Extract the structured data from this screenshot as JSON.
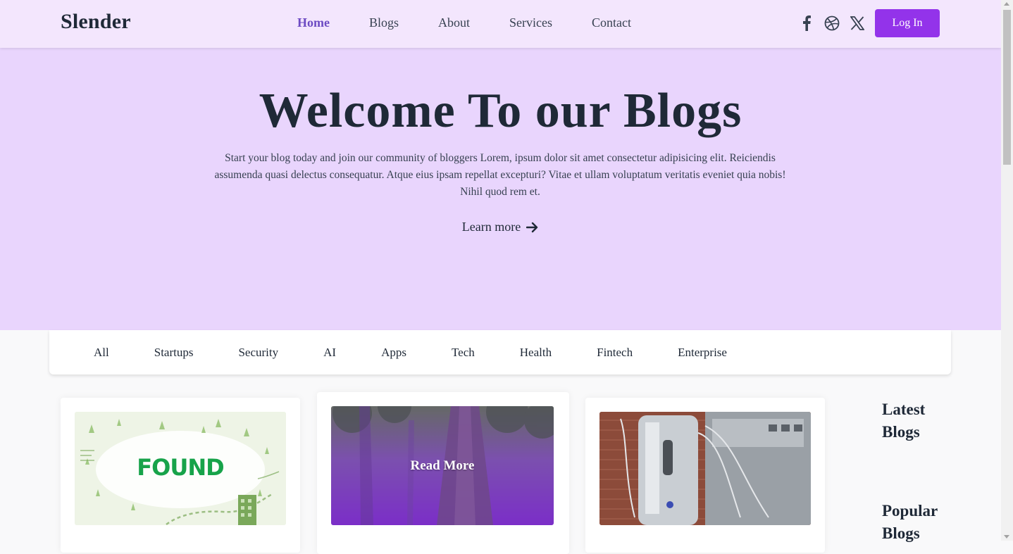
{
  "header": {
    "logo": "Slender",
    "nav": [
      "Home",
      "Blogs",
      "About",
      "Services",
      "Contact"
    ],
    "active_nav": "Home",
    "social_icons": [
      "facebook-icon",
      "dribbble-icon",
      "x-icon"
    ],
    "login_label": "Log In"
  },
  "hero": {
    "title": "Welcome To our Blogs",
    "description": "Start your blog today and join our community of bloggers Lorem, ipsum dolor sit amet consectetur adipisicing elit. Reiciendis assumenda quasi delectus consequatur. Atque eius ipsam repellat excepturi? Vitae et ullam voluptatum veritatis eveniet quia nobis! Nihil quod rem et.",
    "cta": "Learn more"
  },
  "categories": [
    "All",
    "Startups",
    "Security",
    "AI",
    "Apps",
    "Tech",
    "Health",
    "Fintech",
    "Enterprise"
  ],
  "cards": [
    {
      "image_text": "FOUND"
    },
    {
      "overlay": "Read More"
    },
    {}
  ],
  "sidebar": {
    "latest_title": "Latest Blogs",
    "popular_title": "Popular Blogs"
  },
  "colors": {
    "header_bg": "#f3e6fd",
    "hero_bg": "#e9d5fd",
    "accent": "#9333ea",
    "active_nav": "#6d4bc3",
    "text": "#1f2937"
  }
}
